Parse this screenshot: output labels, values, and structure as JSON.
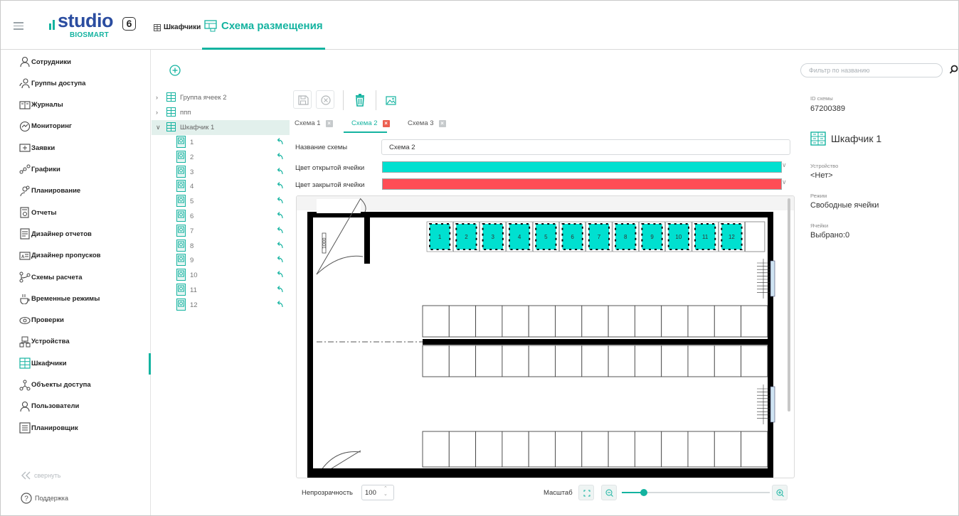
{
  "app": {
    "logo_word": "studio",
    "logo_number": "6",
    "logo_sub": "BIOSMART"
  },
  "breadcrumb": {
    "parent": "Шкафчики",
    "current": "Схема размещения"
  },
  "sidebar": {
    "items": [
      {
        "label": "Сотрудники",
        "icon": "user-icon"
      },
      {
        "label": "Группы доступа",
        "icon": "group-icon"
      },
      {
        "label": "Журналы",
        "icon": "journal-icon"
      },
      {
        "label": "Мониторинг",
        "icon": "monitoring-icon"
      },
      {
        "label": "Заявки",
        "icon": "request-icon"
      },
      {
        "label": "Графики",
        "icon": "schedule-icon"
      },
      {
        "label": "Планирование",
        "icon": "planning-icon"
      },
      {
        "label": "Отчеты",
        "icon": "report-icon"
      },
      {
        "label": "Дизайнер отчетов",
        "icon": "report-designer-icon"
      },
      {
        "label": "Дизайнер пропусков",
        "icon": "pass-designer-icon"
      },
      {
        "label": "Схемы расчета",
        "icon": "calc-scheme-icon"
      },
      {
        "label": "Временные режимы",
        "icon": "time-mode-icon"
      },
      {
        "label": "Проверки",
        "icon": "check-icon"
      },
      {
        "label": "Устройства",
        "icon": "device-icon"
      },
      {
        "label": "Шкафчики",
        "icon": "locker-icon",
        "active": true
      },
      {
        "label": "Объекты доступа",
        "icon": "access-object-icon"
      },
      {
        "label": "Пользователи",
        "icon": "users-icon"
      },
      {
        "label": "Планировщик",
        "icon": "scheduler-icon"
      }
    ],
    "collapse_label": "свернуть",
    "support_label": "Поддержка"
  },
  "filter": {
    "placeholder": "Фильтр по названию"
  },
  "tree": {
    "groups": [
      {
        "label": "Группа ячеек 2",
        "expanded": false
      },
      {
        "label": "ппп",
        "expanded": false
      },
      {
        "label": "Шкафчик 1",
        "expanded": true,
        "selected": true
      }
    ],
    "cells": [
      "1",
      "2",
      "3",
      "4",
      "5",
      "6",
      "7",
      "8",
      "9",
      "10",
      "11",
      "12"
    ]
  },
  "editor": {
    "tabs": [
      {
        "label": "Схема 1",
        "active": false
      },
      {
        "label": "Схема 2",
        "active": true
      },
      {
        "label": "Схема 3",
        "active": false
      }
    ],
    "fields": {
      "name_label": "Название схемы",
      "name_value": "Схема 2",
      "open_color_label": "Цвет открытой ячейки",
      "open_color": "#00e0d0",
      "closed_color_label": "Цвет закрытой ячейки",
      "closed_color": "#ff4d55"
    },
    "plan": {
      "locker_labels": [
        "1",
        "2",
        "3",
        "4",
        "5",
        "6",
        "7",
        "8",
        "9",
        "10",
        "11",
        "12"
      ],
      "dimension_label": "1000"
    },
    "opacity_label": "Непрозрачность",
    "opacity_value": "100",
    "zoom_label": "Масштаб",
    "zoom_level": 0.15
  },
  "properties": {
    "id_label": "ID схемы",
    "id_value": "67200389",
    "name": "Шкафчик 1",
    "device_label": "Устройство",
    "device_value": "<Нет>",
    "mode_label": "Режим",
    "mode_value": "Свободные ячейки",
    "cells_label": "Ячейки",
    "cells_value": "Выбрано:0"
  },
  "colors": {
    "accent": "#14b3a0",
    "brand_blue": "#2b4da0",
    "danger": "#ec5e4f"
  }
}
